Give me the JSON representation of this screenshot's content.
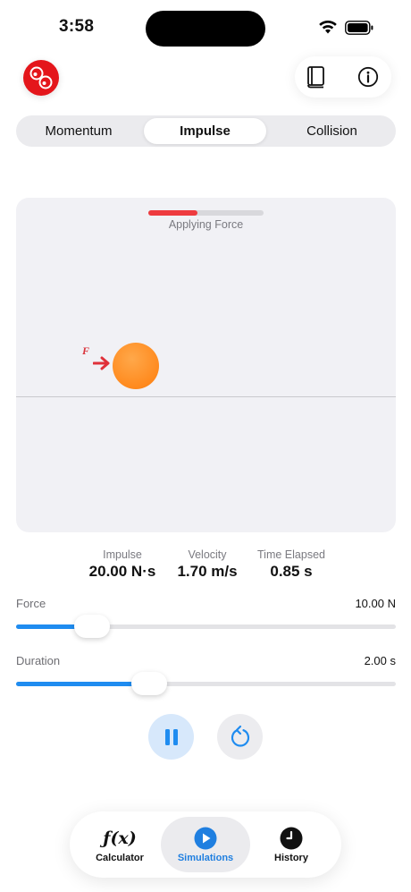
{
  "status_bar": {
    "time": "3:58",
    "icons": [
      "wifi-icon",
      "battery-icon"
    ]
  },
  "header": {
    "logo": "app-logo",
    "buttons": [
      "book-icon",
      "info-icon"
    ]
  },
  "segments": [
    {
      "label": "Momentum",
      "active": false
    },
    {
      "label": "Impulse",
      "active": true
    },
    {
      "label": "Collision",
      "active": false
    }
  ],
  "simulation": {
    "status_label": "Applying Force",
    "progress": 0.425,
    "force_symbol": "F",
    "colors": {
      "ball": "#ff8a1e",
      "force": "#e0313a",
      "progress": "#ee3b3f"
    }
  },
  "stats": [
    {
      "label": "Impulse",
      "value": "20.00 N·s"
    },
    {
      "label": "Velocity",
      "value": "1.70 m/s"
    },
    {
      "label": "Time Elapsed",
      "value": "0.85 s"
    }
  ],
  "sliders": {
    "force": {
      "label": "Force",
      "value": "10.00 N",
      "fraction": 0.2
    },
    "duration": {
      "label": "Duration",
      "value": "2.00 s",
      "fraction": 0.35
    }
  },
  "controls": {
    "pause": "pause-icon",
    "reset": "reset-icon"
  },
  "tabbar": [
    {
      "label": "Calculator",
      "icon": "function-icon",
      "active": false
    },
    {
      "label": "Simulations",
      "icon": "play-icon",
      "active": true
    },
    {
      "label": "History",
      "icon": "clock-icon",
      "active": false
    }
  ],
  "accent_color": "#1f8cf0"
}
